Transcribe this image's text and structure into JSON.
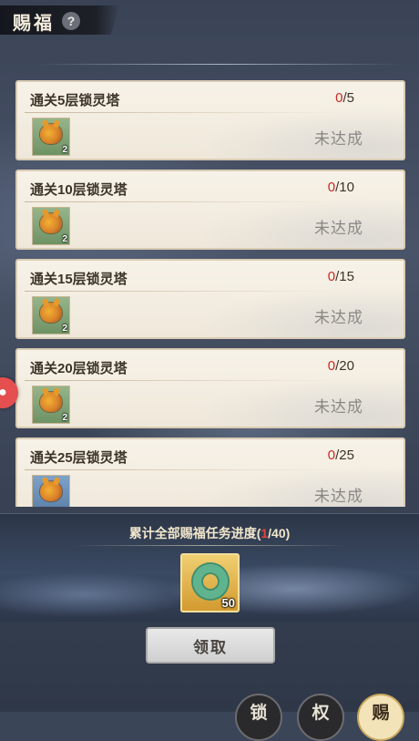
{
  "header": {
    "title": "赐福",
    "help_icon": "?"
  },
  "side_button": {
    "icon": "red-round-icon"
  },
  "tasks": [
    {
      "name": "通关5层锁灵塔",
      "current": "0",
      "target": "/5",
      "reward_qty": "2",
      "status": "未达成"
    },
    {
      "name": "通关10层锁灵塔",
      "current": "0",
      "target": "/10",
      "reward_qty": "2",
      "status": "未达成"
    },
    {
      "name": "通关15层锁灵塔",
      "current": "0",
      "target": "/15",
      "reward_qty": "2",
      "status": "未达成"
    },
    {
      "name": "通关20层锁灵塔",
      "current": "0",
      "target": "/20",
      "reward_qty": "2",
      "status": "未达成"
    },
    {
      "name": "通关25层锁灵塔",
      "current": "0",
      "target": "/25",
      "reward_qty": "",
      "status": "未达成"
    }
  ],
  "total": {
    "prefix": "累计全部赐福任务进度(",
    "current": "1",
    "suffix": "/40)"
  },
  "big_reward": {
    "qty": "50"
  },
  "claim_button": "领取",
  "nav": {
    "item1": "锁",
    "item2": "权",
    "item3": "赐"
  }
}
